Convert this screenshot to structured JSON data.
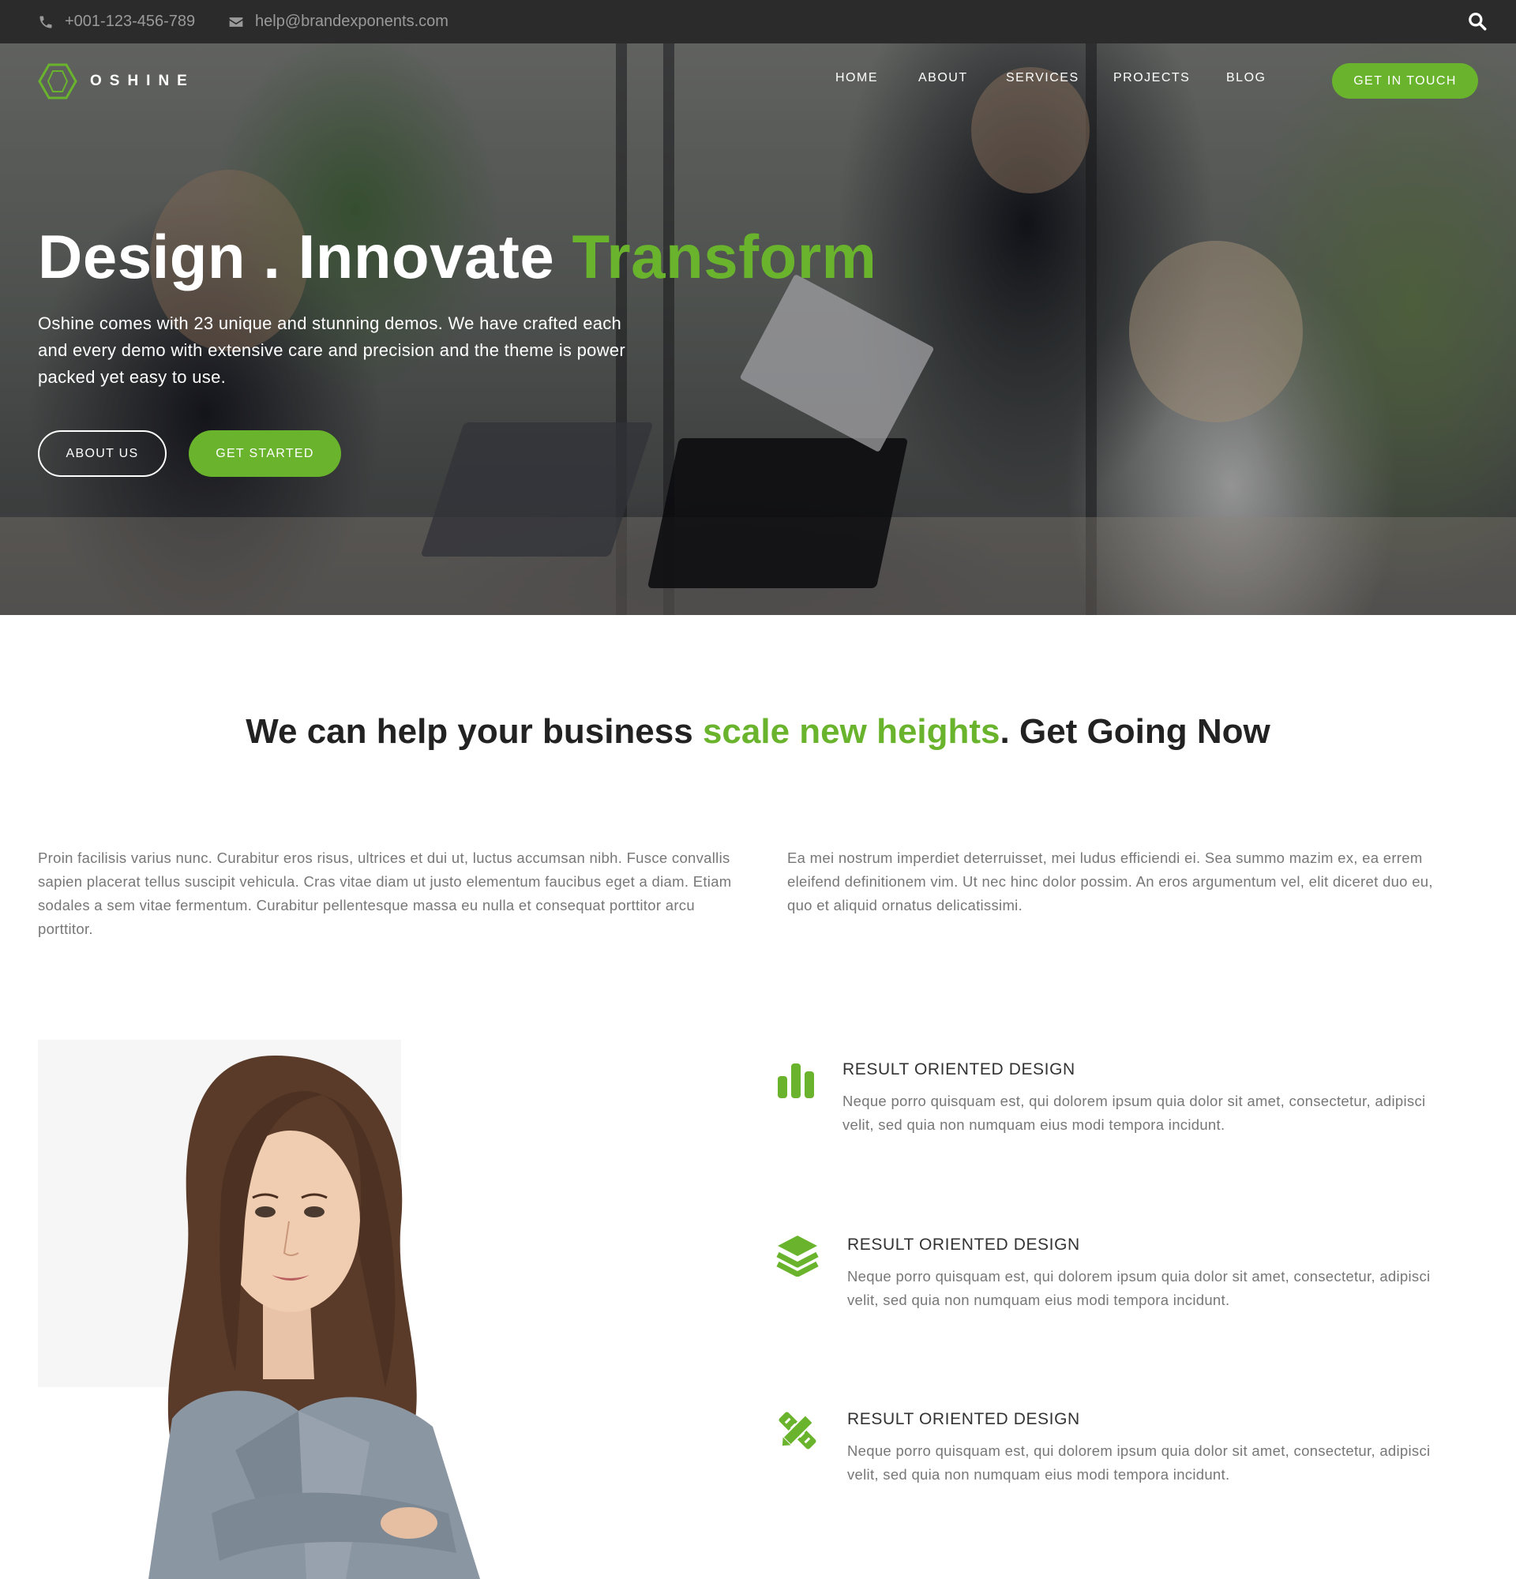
{
  "topbar": {
    "phone": "+001-123-456-789",
    "email": "help@brandexponents.com"
  },
  "brand": {
    "name": "OSHINE",
    "accent_color": "#6ab42d"
  },
  "nav": {
    "items": [
      {
        "label": "HOME"
      },
      {
        "label": "ABOUT"
      },
      {
        "label": "SERVICES"
      },
      {
        "label": "PROJECTS"
      },
      {
        "label": "BLOG"
      }
    ],
    "cta": "GET IN TOUCH"
  },
  "hero": {
    "title_main": "Design . Innovate ",
    "title_accent": "Transform",
    "subtitle": "Oshine comes with 23 unique and stunning demos. We have crafted each and every demo with extensive care and precision and the theme is power packed yet easy to use.",
    "button_secondary": "ABOUT US",
    "button_primary": "GET STARTED"
  },
  "intro": {
    "title_before": "We can help your business ",
    "title_accent": "scale new heights",
    "title_after": ". Get Going Now",
    "left_text": "Proin facilisis varius nunc. Curabitur eros risus, ultrices et dui ut, luctus accumsan nibh. Fusce convallis sapien placerat tellus suscipit vehicula. Cras vitae diam ut justo elementum faucibus eget a diam. Etiam sodales a sem vitae fermentum. Curabitur pellentesque massa eu nulla et consequat porttitor arcu porttitor.",
    "right_text": "Ea mei nostrum imperdiet deterruisset, mei ludus efficiendi ei. Sea summo mazim ex, ea errem eleifend definitionem vim. Ut nec hinc dolor possim. An eros argumentum vel, elit diceret duo eu, quo et aliquid ornatus delicatissimi."
  },
  "features": [
    {
      "icon": "bar-chart-icon",
      "title": "RESULT ORIENTED DESIGN",
      "text": "Neque porro quisquam est, qui dolorem ipsum quia dolor sit amet, consectetur, adipisci velit, sed quia non numquam eius modi tempora incidunt."
    },
    {
      "icon": "layers-icon",
      "title": "RESULT ORIENTED DESIGN",
      "text": "Neque porro quisquam est, qui dolorem ipsum quia dolor sit amet, consectetur, adipisci velit, sed quia non numquam eius modi tempora incidunt."
    },
    {
      "icon": "pencil-ruler-icon",
      "title": "RESULT ORIENTED DESIGN",
      "text": "Neque porro quisquam est, qui dolorem ipsum quia dolor sit amet, consectetur, adipisci velit, sed quia non numquam eius modi tempora incidunt."
    }
  ]
}
